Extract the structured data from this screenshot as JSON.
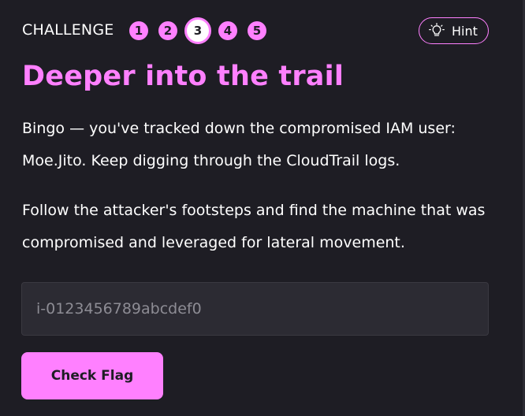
{
  "header": {
    "challenge_label": "CHALLENGE",
    "steps": [
      {
        "label": "1",
        "state": "completed"
      },
      {
        "label": "2",
        "state": "completed"
      },
      {
        "label": "3",
        "state": "current"
      },
      {
        "label": "4",
        "state": "upcoming"
      },
      {
        "label": "5",
        "state": "upcoming"
      }
    ],
    "hint": {
      "label": "Hint",
      "icon": "lightbulb-icon"
    }
  },
  "title": "Deeper into the trail",
  "paragraphs": [
    "Bingo — you've tracked down the compromised IAM user: Moe.Jito. Keep digging through the CloudTrail logs.",
    "Follow the attacker's footsteps and find the machine that was compromised and leveraged for lateral movement."
  ],
  "flag_input": {
    "value": "",
    "placeholder": "i-0123456789abcdef0"
  },
  "check_button": {
    "label": "Check Flag"
  },
  "colors": {
    "background": "#1e1d24",
    "accent": "#ff80ff",
    "input_background": "#2c2b33",
    "text": "#ffffff",
    "placeholder": "#8d8c94"
  }
}
